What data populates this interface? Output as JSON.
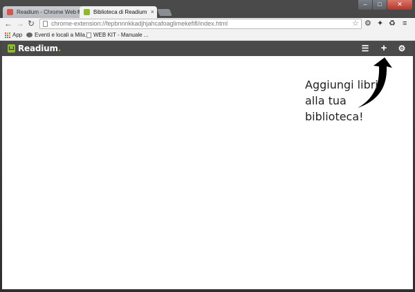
{
  "browser": {
    "tabs": [
      {
        "label": "Readium - Chrome Web S",
        "active": false
      },
      {
        "label": "Biblioteca di Readium",
        "active": true
      }
    ],
    "tab_close_glyph": "×",
    "url": "chrome-extension://fepbnnnkkadjhjahcafoaglimekefifl/index.html",
    "bookmarks": [
      {
        "label": "App",
        "icon": "apps-grid-icon"
      },
      {
        "label": "Eventi e locali a Mila...",
        "icon": "site-icon"
      },
      {
        "label": "WEB KIT - Manuale ...",
        "icon": "page-icon"
      }
    ]
  },
  "readium": {
    "app_name": "Readium",
    "toolbar_icons": [
      "list-view-icon",
      "add-book-icon",
      "settings-icon"
    ],
    "hint": "Aggiungi libri\nalla tua\nbiblioteca!"
  },
  "colors": {
    "app_bar": "#4a4a4a",
    "brand_green": "#8fb82c",
    "content_bg": "#ffffff"
  }
}
